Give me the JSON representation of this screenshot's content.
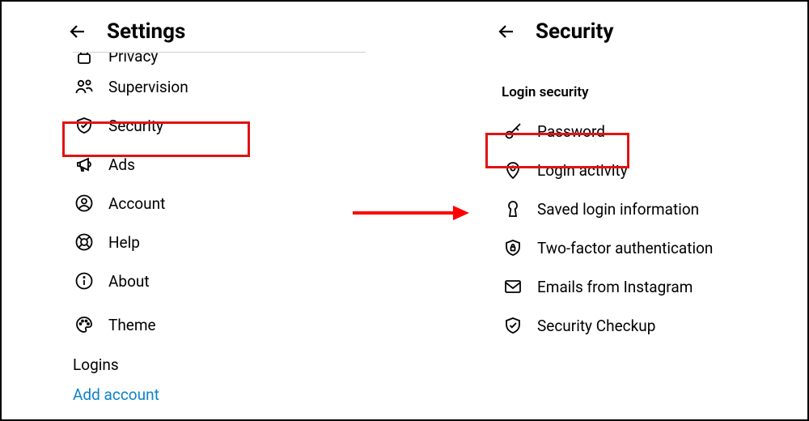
{
  "left": {
    "title": "Settings",
    "cutoff_item": {
      "label": "Privacy"
    },
    "items": [
      {
        "label": "Supervision"
      },
      {
        "label": "Security"
      },
      {
        "label": "Ads"
      },
      {
        "label": "Account"
      },
      {
        "label": "Help"
      },
      {
        "label": "About"
      },
      {
        "label": "Theme"
      }
    ],
    "logins_heading": "Logins",
    "add_account": "Add account"
  },
  "right": {
    "title": "Security",
    "section": "Login security",
    "items": [
      {
        "label": "Password"
      },
      {
        "label": "Login activity"
      },
      {
        "label": "Saved login information"
      },
      {
        "label": "Two-factor authentication"
      },
      {
        "label": "Emails from Instagram"
      },
      {
        "label": "Security Checkup"
      }
    ]
  },
  "colors": {
    "highlight": "#e11313",
    "link": "#0a84c8",
    "arrow": "#ff0000"
  }
}
